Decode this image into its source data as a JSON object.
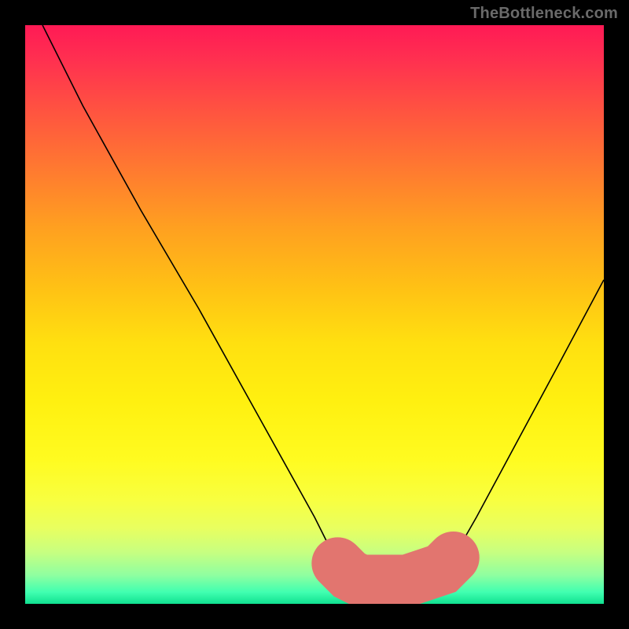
{
  "watermark": "TheBottleneck.com",
  "chart_data": {
    "type": "line",
    "title": "",
    "xlabel": "",
    "ylabel": "",
    "xlim": [
      0,
      100
    ],
    "ylim": [
      0,
      100
    ],
    "grid": false,
    "legend": false,
    "series": [
      {
        "name": "bottleneck-curve",
        "x": [
          3,
          10,
          20,
          30,
          40,
          50,
          54,
          56,
          58,
          60,
          63,
          66,
          69,
          72,
          74,
          78,
          85,
          92,
          100
        ],
        "y": [
          100,
          86,
          68,
          51,
          33,
          15,
          7,
          5,
          4,
          4,
          4,
          4,
          5,
          6,
          8,
          15,
          28,
          41,
          56
        ],
        "color": "#000000"
      },
      {
        "name": "highlight-segment",
        "x": [
          54,
          56,
          58,
          60,
          63,
          66,
          69,
          72,
          74
        ],
        "y": [
          7,
          5,
          4,
          4,
          4,
          4,
          5,
          6,
          8
        ],
        "color": "#e2756f"
      }
    ],
    "annotations": []
  }
}
